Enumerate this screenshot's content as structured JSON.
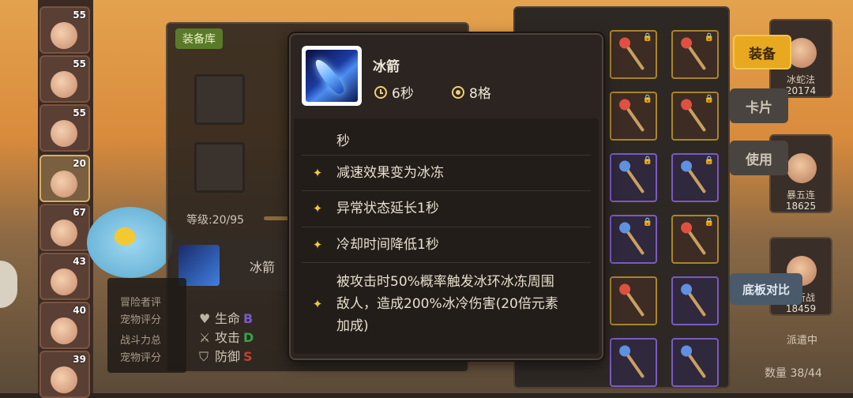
{
  "left_heroes": [
    {
      "level": "55"
    },
    {
      "level": "55"
    },
    {
      "level": "55"
    },
    {
      "level": "20"
    },
    {
      "level": "67"
    },
    {
      "level": "43"
    },
    {
      "level": "40"
    },
    {
      "level": "39"
    }
  ],
  "equip_panel": {
    "library_label": "装备库",
    "level_text": "等级:20/95",
    "equipped_item_name": "冰箭",
    "eval_lines": [
      "冒险者评",
      "宠物评分",
      "战斗力总",
      "宠物评分"
    ],
    "stats": [
      {
        "label": "生命",
        "grade": "B",
        "grade_color": "#7a5ac8"
      },
      {
        "label": "攻击",
        "grade": "D",
        "grade_color": "#3aa04a"
      },
      {
        "label": "防御",
        "grade": "S",
        "grade_color": "#c04030"
      }
    ]
  },
  "tooltip": {
    "item_name": "冰箭",
    "cooldown": "6秒",
    "range": "8格",
    "cut_line_tail": "秒",
    "effects": [
      "减速效果变为冰冻",
      "异常状态延长1秒",
      "冷却时间降低1秒",
      "被攻击时50%概率触发冰环冰冻周围敌人，造成200%冰冷伤害(20倍元素加成)"
    ],
    "effect_lines": [
      [
        "减速效果变为冰冻"
      ],
      [
        "异常状态延长1秒"
      ],
      [
        "冷却时间降低1秒"
      ],
      [
        "被攻击时50%概率触发冰环冰冻周围",
        "敌人，造成200%冰冷伤害(20倍元素",
        "加成)"
      ]
    ]
  },
  "actions": {
    "equip": "装备",
    "card": "卡片",
    "use": "使用",
    "compare": "底板对比"
  },
  "heroes_right": [
    {
      "name": "冰蛇法",
      "power": "20174"
    },
    {
      "name": "暴五连",
      "power": "18625"
    },
    {
      "name": "破斩战",
      "power": "18459"
    }
  ],
  "dispatch_label": "派遣中",
  "quantity": "数量 38/44",
  "colors": {
    "accent_gold": "#e8a820",
    "star": "#f0c840",
    "tooltip_bg": "#2b2421"
  }
}
